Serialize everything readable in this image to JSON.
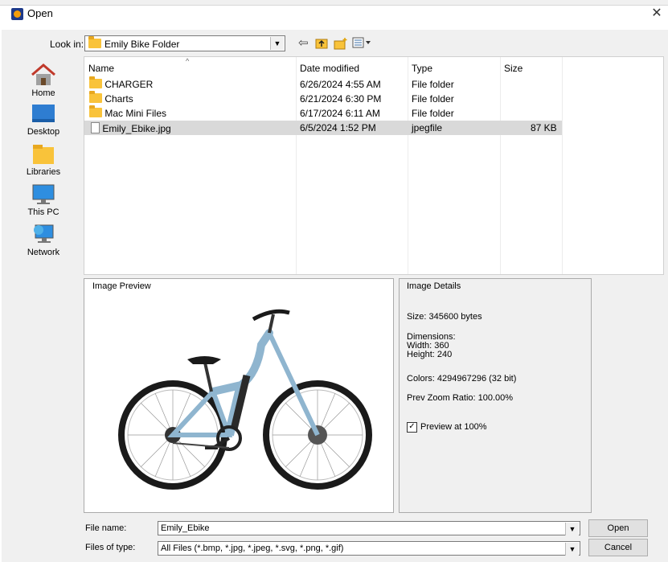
{
  "window": {
    "title": "Open",
    "close_glyph": "✕"
  },
  "toolbar": {
    "look_in_label": "Look in:",
    "look_in_value": "Emily Bike Folder",
    "back_icon": "back-arrow-icon",
    "up_icon": "up-folder-icon",
    "new_folder_icon": "new-folder-icon",
    "view_icon": "view-menu-icon"
  },
  "places": [
    {
      "label": "Home",
      "icon": "home-icon"
    },
    {
      "label": "Desktop",
      "icon": "desktop-icon"
    },
    {
      "label": "Libraries",
      "icon": "libraries-icon"
    },
    {
      "label": "This PC",
      "icon": "computer-icon"
    },
    {
      "label": "Network",
      "icon": "network-icon"
    }
  ],
  "columns": {
    "name": "Name",
    "date": "Date modified",
    "type": "Type",
    "size": "Size"
  },
  "files": [
    {
      "name": "CHARGER",
      "date": "6/26/2024 4:55 AM",
      "type": "File folder",
      "size": "",
      "kind": "folder"
    },
    {
      "name": "Charts",
      "date": "6/21/2024 6:30 PM",
      "type": "File folder",
      "size": "",
      "kind": "folder"
    },
    {
      "name": "Mac Mini Files",
      "date": "6/17/2024 6:11 AM",
      "type": "File folder",
      "size": "",
      "kind": "folder"
    },
    {
      "name": "Emily_Ebike.jpg",
      "date": "6/5/2024 1:52 PM",
      "type": "jpegfile",
      "size": "87 KB",
      "kind": "file",
      "selected": true
    }
  ],
  "preview": {
    "title": "Image Preview"
  },
  "details": {
    "title": "Image Details",
    "size": "Size: 345600 bytes",
    "dimensions_label": "Dimensions:",
    "width": "Width: 360",
    "height": "Height: 240",
    "colors": "Colors: 4294967296 (32 bit)",
    "zoom": "Prev Zoom Ratio: 100.00%",
    "preview_checkbox_label": "Preview at 100%",
    "preview_checked": true
  },
  "bottom": {
    "file_name_label": "File name:",
    "file_name_value": "Emily_Ebike",
    "file_type_label": "Files of type:",
    "file_type_value": "All Files (*.bmp, *.jpg, *.jpeg, *.svg, *.png, *.gif)",
    "open_label": "Open",
    "cancel_label": "Cancel"
  },
  "colors": {
    "selection": "#d9d9d9",
    "dialog_bg": "#f0f0f0",
    "bike_frame": "#8fb5cf"
  }
}
